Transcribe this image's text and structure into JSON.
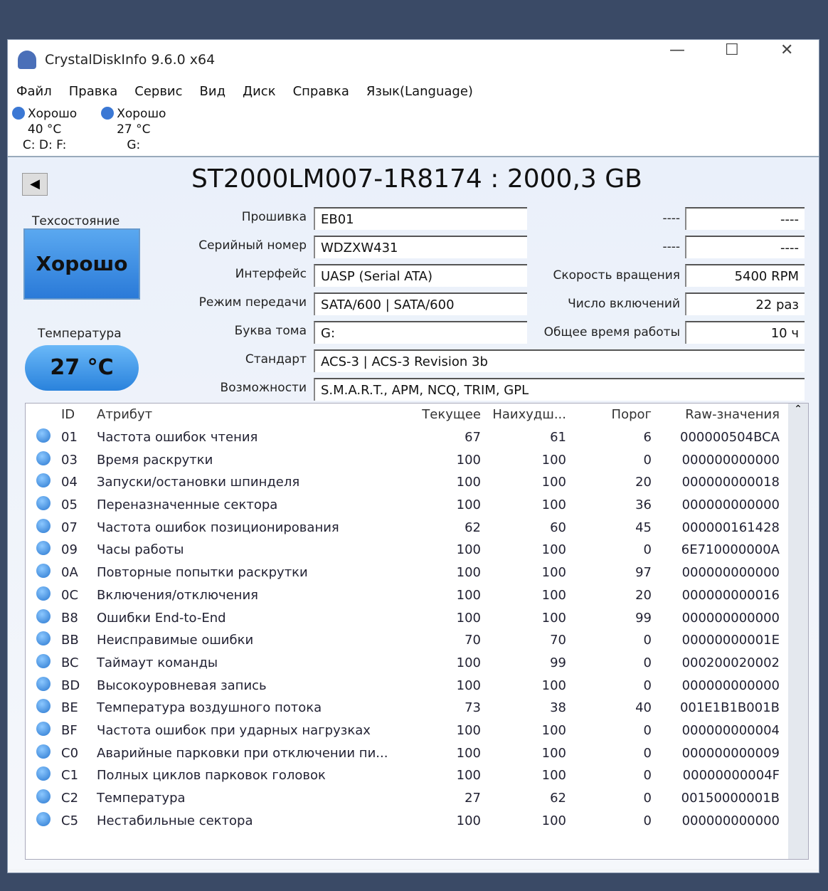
{
  "window": {
    "title": "CrystalDiskInfo 9.6.0 x64",
    "minimize": "—",
    "maximize": "☐",
    "close": "✕"
  },
  "menu": [
    "Файл",
    "Правка",
    "Сервис",
    "Вид",
    "Диск",
    "Справка",
    "Язык(Language)"
  ],
  "disks": [
    {
      "status": "Хорошо",
      "temp": "40 °C",
      "letters": "C: D: F:"
    },
    {
      "status": "Хорошо",
      "temp": "27 °C",
      "letters": "G:"
    }
  ],
  "model": "ST2000LM007-1R8174 : 2000,3 GB",
  "health": {
    "label": "Техсостояние",
    "value": "Хорошо"
  },
  "temperature": {
    "label": "Температура",
    "value": "27 °C"
  },
  "info": [
    {
      "label": "Прошивка",
      "value": "EB01"
    },
    {
      "label": "Серийный номер",
      "value": "WDZXW431"
    },
    {
      "label": "Интерфейс",
      "value": "UASP (Serial ATA)"
    },
    {
      "label": "Режим передачи",
      "value": "SATA/600 | SATA/600"
    },
    {
      "label": "Буква тома",
      "value": "G:"
    },
    {
      "label": "Стандарт",
      "value": "ACS-3 | ACS-3 Revision 3b"
    },
    {
      "label": "Возможности",
      "value": "S.M.A.R.T., APM, NCQ, TRIM, GPL"
    }
  ],
  "right_info": [
    {
      "label": "----",
      "value": "----"
    },
    {
      "label": "----",
      "value": "----"
    },
    {
      "label": "Скорость вращения",
      "value": "5400 RPM"
    },
    {
      "label": "Число включений",
      "value": "22 раз"
    },
    {
      "label": "Общее время работы",
      "value": "10 ч"
    }
  ],
  "table": {
    "headers": [
      "ID",
      "Атрибут",
      "Текущее",
      "Наихудш...",
      "Порог",
      "Raw-значения"
    ],
    "rows": [
      [
        "01",
        "Частота ошибок чтения",
        "67",
        "61",
        "6",
        "000000504BCA"
      ],
      [
        "03",
        "Время раскрутки",
        "100",
        "100",
        "0",
        "000000000000"
      ],
      [
        "04",
        "Запуски/остановки шпинделя",
        "100",
        "100",
        "20",
        "000000000018"
      ],
      [
        "05",
        "Переназначенные сектора",
        "100",
        "100",
        "36",
        "000000000000"
      ],
      [
        "07",
        "Частота ошибок позиционирования",
        "62",
        "60",
        "45",
        "000000161428"
      ],
      [
        "09",
        "Часы работы",
        "100",
        "100",
        "0",
        "6E710000000A"
      ],
      [
        "0A",
        "Повторные попытки раскрутки",
        "100",
        "100",
        "97",
        "000000000000"
      ],
      [
        "0C",
        "Включения/отключения",
        "100",
        "100",
        "20",
        "000000000016"
      ],
      [
        "B8",
        "Ошибки End-to-End",
        "100",
        "100",
        "99",
        "000000000000"
      ],
      [
        "BB",
        "Неисправимые ошибки",
        "70",
        "70",
        "0",
        "00000000001E"
      ],
      [
        "BC",
        "Таймаут команды",
        "100",
        "99",
        "0",
        "000200020002"
      ],
      [
        "BD",
        "Высокоуровневая запись",
        "100",
        "100",
        "0",
        "000000000000"
      ],
      [
        "BE",
        "Температура воздушного потока",
        "73",
        "38",
        "40",
        "001E1B1B001B"
      ],
      [
        "BF",
        "Частота ошибок при ударных нагрузках",
        "100",
        "100",
        "0",
        "000000000004"
      ],
      [
        "C0",
        "Аварийные парковки при отключении пи...",
        "100",
        "100",
        "0",
        "000000000009"
      ],
      [
        "C1",
        "Полных циклов парковок головок",
        "100",
        "100",
        "0",
        "00000000004F"
      ],
      [
        "C2",
        "Температура",
        "27",
        "62",
        "0",
        "00150000001B"
      ],
      [
        "C5",
        "Нестабильные сектора",
        "100",
        "100",
        "0",
        "000000000000"
      ]
    ]
  }
}
